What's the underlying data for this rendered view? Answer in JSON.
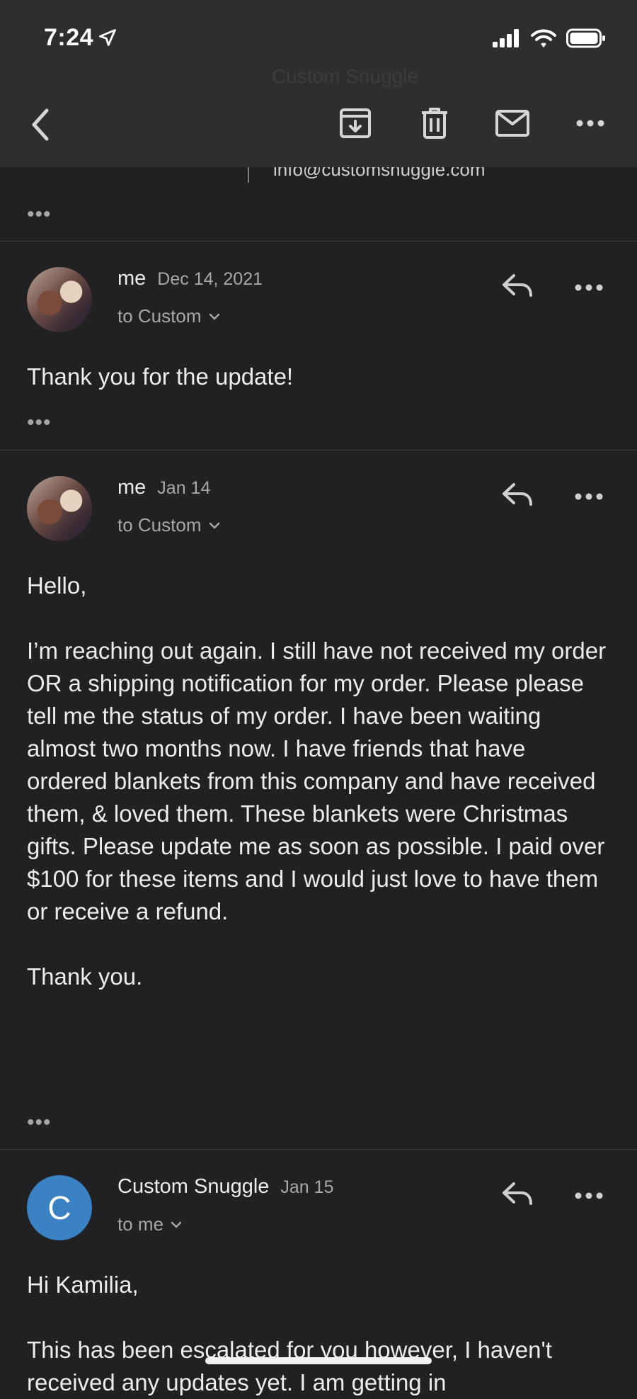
{
  "status": {
    "time": "7:24"
  },
  "peek": {
    "ghost_name": "Custom Snuggle",
    "email": "info@customsnuggle.com"
  },
  "messages": [
    {
      "sender": "me",
      "date": "Dec 14, 2021",
      "recipient": "to Custom",
      "body": [
        "Thank you for the update!"
      ]
    },
    {
      "sender": "me",
      "date": "Jan 14",
      "recipient": "to Custom",
      "body": [
        "Hello,",
        "I’m reaching out again. I still have not received my order OR a shipping notification for my order. Please please tell me the status of my order. I have been waiting almost two months now. I have friends that have ordered blankets from this company and have received them, & loved them. These blankets were Christmas gifts. Please update me as soon as possible. I paid over $100 for these items and I would just love to have them or receive a refund.",
        "Thank you."
      ]
    },
    {
      "sender": "Custom Snuggle",
      "date": "Jan 15",
      "recipient": "to me",
      "avatar_letter": "C",
      "body": [
        "Hi Kamilia,",
        "This has been escalated for you however, I haven't received any updates yet. I am getting in"
      ]
    }
  ],
  "icons": {
    "back": "chevron-left-icon",
    "archive": "archive-icon",
    "trash": "trash-icon",
    "mail": "mail-icon",
    "more": "more-horizontal-icon",
    "reply": "reply-icon"
  },
  "colors": {
    "background": "#212124",
    "header": "#2e2e31",
    "avatar_blue": "#3b82c4"
  }
}
